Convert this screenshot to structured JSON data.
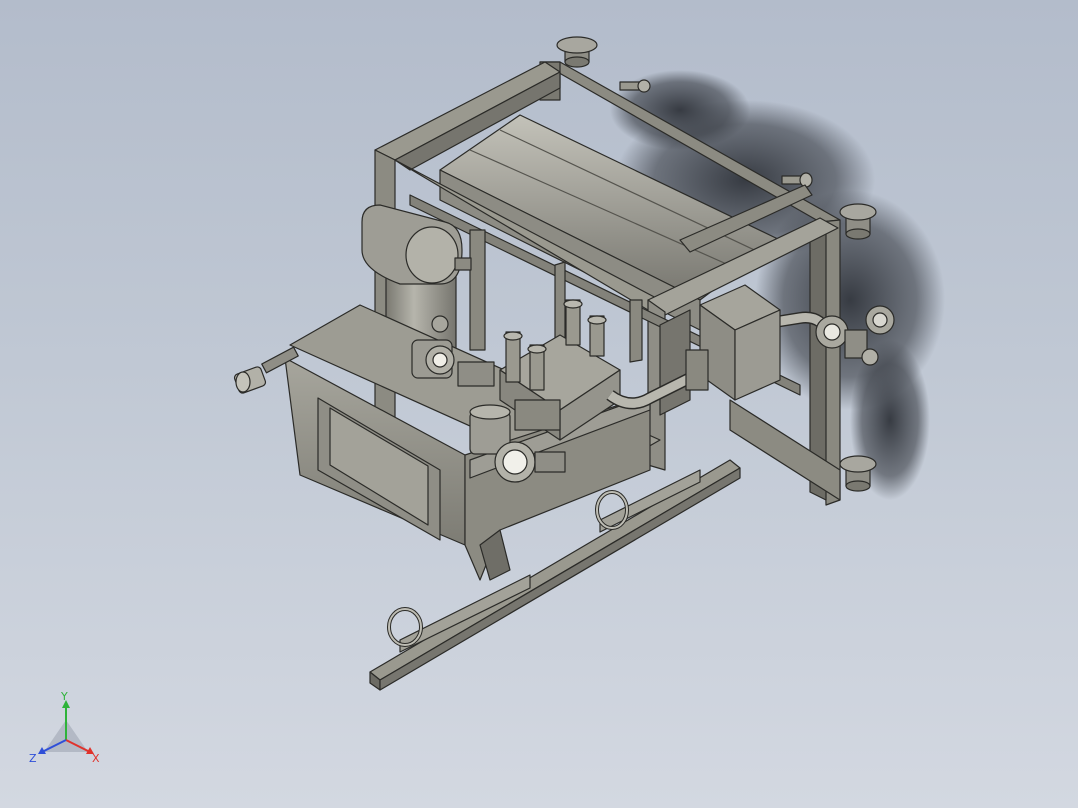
{
  "viewport": {
    "background_top": "#b3bccb",
    "background_bottom": "#d3d8e1"
  },
  "model": {
    "name": "hydraulic-power-unit",
    "metal_color": "#8c8b82",
    "metal_light": "#aeada4",
    "metal_dark": "#5f5e57",
    "edge_color": "#2b2b28",
    "shadow_color": "#3a3e45"
  },
  "triad": {
    "x_label": "X",
    "y_label": "Y",
    "z_label": "Z",
    "x_color": "#e0322b",
    "y_color": "#2fb33a",
    "z_color": "#2f4fd8"
  }
}
